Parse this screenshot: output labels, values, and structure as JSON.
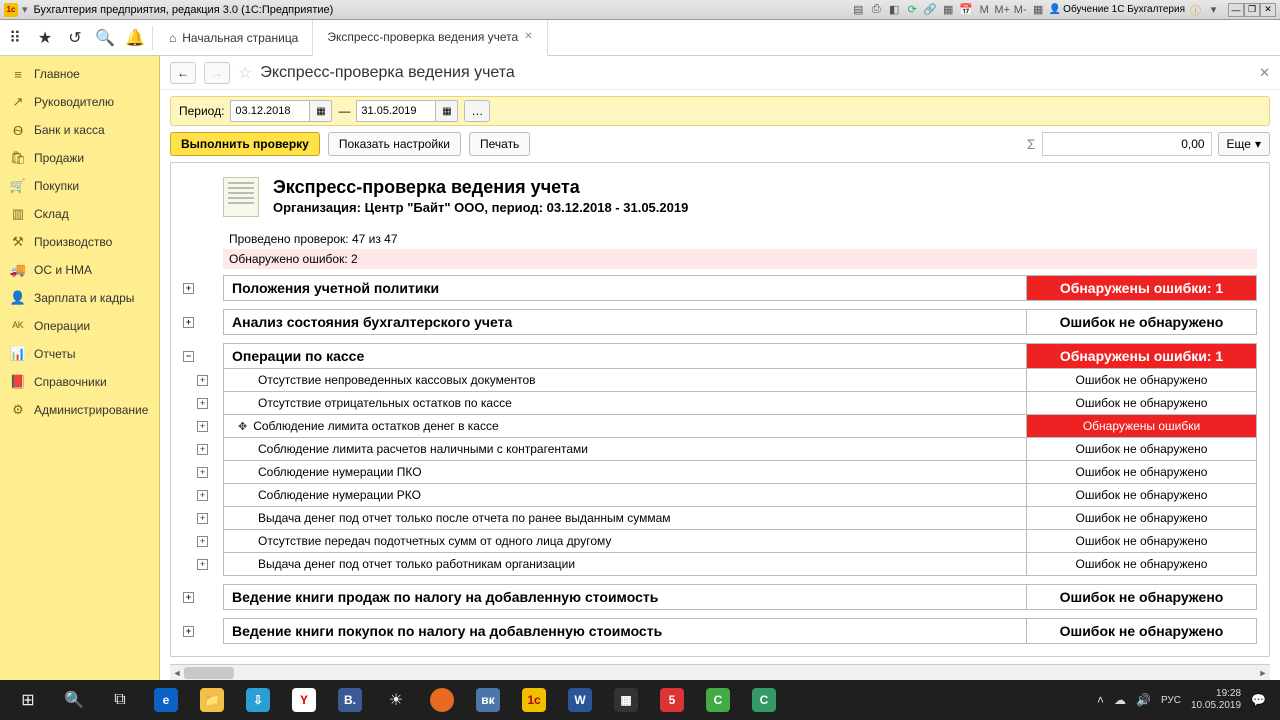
{
  "window": {
    "title": "Бухгалтерия предприятия, редакция 3.0  (1С:Предприятие)",
    "user_label": "Обучение 1С Бухгалтерия",
    "m_labels": [
      "M",
      "M+",
      "M-"
    ]
  },
  "toolbar_tabs": {
    "home": "Начальная страница",
    "active": "Экспресс-проверка ведения учета"
  },
  "sidebar": [
    {
      "icon": "≡",
      "label": "Главное"
    },
    {
      "icon": "↗",
      "label": "Руководителю"
    },
    {
      "icon": "Ѳ",
      "label": "Банк и касса"
    },
    {
      "icon": "🛍",
      "label": "Продажи"
    },
    {
      "icon": "🛒",
      "label": "Покупки"
    },
    {
      "icon": "▥",
      "label": "Склад"
    },
    {
      "icon": "⚒",
      "label": "Производство"
    },
    {
      "icon": "🚚",
      "label": "ОС и НМА"
    },
    {
      "icon": "👤",
      "label": "Зарплата и кадры"
    },
    {
      "icon": "ᴬᴷ",
      "label": "Операции"
    },
    {
      "icon": "📊",
      "label": "Отчеты"
    },
    {
      "icon": "📕",
      "label": "Справочники"
    },
    {
      "icon": "⚙",
      "label": "Администрирование"
    }
  ],
  "page": {
    "title": "Экспресс-проверка ведения учета",
    "period_label": "Период:",
    "date_from": "03.12.2018",
    "dash": "—",
    "date_to": "31.05.2019",
    "run_check": "Выполнить проверку",
    "show_settings": "Показать настройки",
    "print": "Печать",
    "sum_value": "0,00",
    "more": "Еще"
  },
  "report": {
    "title": "Экспресс-проверка ведения учета",
    "subtitle": "Организация: Центр \"Байт\" ООО, период: 03.12.2018 - 31.05.2019",
    "checks_line": "Проведено проверок: 47 из 47",
    "errors_line": "Обнаружено ошибок: 2",
    "status_ok": "Ошибок не обнаружено",
    "status_err_1": "Обнаружены ошибки: 1",
    "status_err": "Обнаружены ошибки",
    "sections": [
      {
        "name": "Положения учетной политики",
        "status": "err1"
      },
      {
        "name": "Анализ состояния бухгалтерского учета",
        "status": "ok"
      },
      {
        "name": "Операции по кассе",
        "status": "err1",
        "expanded": true,
        "children": [
          {
            "name": "Отсутствие непроведенных кассовых документов",
            "status": "ok"
          },
          {
            "name": "Отсутствие отрицательных остатков по кассе",
            "status": "ok"
          },
          {
            "name": "Соблюдение лимита остатков денег в кассе",
            "status": "err"
          },
          {
            "name": "Соблюдение лимита расчетов наличными с контрагентами",
            "status": "ok"
          },
          {
            "name": "Соблюдение нумерации ПКО",
            "status": "ok"
          },
          {
            "name": "Соблюдение нумерации РКО",
            "status": "ok"
          },
          {
            "name": "Выдача денег под отчет только после отчета по ранее выданным суммам",
            "status": "ok"
          },
          {
            "name": "Отсутствие передач подотчетных сумм от одного лица другому",
            "status": "ok"
          },
          {
            "name": "Выдача денег под отчет только работникам организации",
            "status": "ok"
          }
        ]
      },
      {
        "name": "Ведение книги продаж по налогу на добавленную стоимость",
        "status": "ok"
      },
      {
        "name": "Ведение книги покупок по налогу на добавленную стоимость",
        "status": "ok"
      }
    ]
  },
  "taskbar": {
    "time": "19:28",
    "date": "10.05.2019",
    "lang": "РУС"
  }
}
